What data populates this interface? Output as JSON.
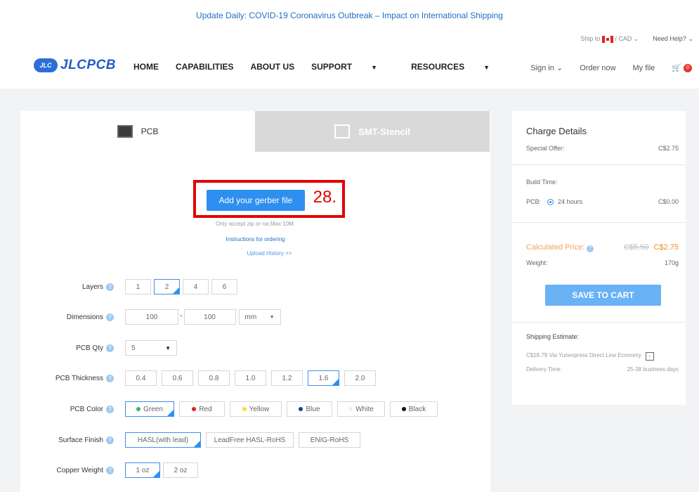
{
  "announcement": "Update Daily: COVID-19 Coronavirus Outbreak – Impact on International Shipping",
  "topbar": {
    "ship_to": "Ship to",
    "currency": "/ CAD",
    "need_help": "Need Help?"
  },
  "brand": {
    "mark": "JLC",
    "name": "JLCPCB"
  },
  "nav": {
    "home": "HOME",
    "capabilities": "CAPABILITIES",
    "about": "ABOUT US",
    "support": "SUPPORT",
    "resources": "RESOURCES"
  },
  "account": {
    "sign_in": "Sign in",
    "order_now": "Order now",
    "my_file": "My file",
    "cart_count": "0"
  },
  "tabs": {
    "pcb": "PCB",
    "stencil": "SMT-Stencil"
  },
  "upload": {
    "button": "Add your gerber file",
    "step_number": "28.",
    "accept_note": "Only accept zip or rar,Max 10M.",
    "instructions": "Instructions for ordering",
    "history": "Upload History >>"
  },
  "form": {
    "layers": {
      "label": "Layers",
      "options": [
        "1",
        "2",
        "4",
        "6"
      ],
      "selected": "2"
    },
    "dimensions": {
      "label": "Dimensions",
      "width": "100",
      "sep": "*",
      "height": "100",
      "unit": "mm"
    },
    "qty": {
      "label": "PCB Qty",
      "value": "5"
    },
    "thickness": {
      "label": "PCB Thickness",
      "options": [
        "0.4",
        "0.6",
        "0.8",
        "1.0",
        "1.2",
        "1.6",
        "2.0"
      ],
      "selected": "1.6"
    },
    "color": {
      "label": "PCB Color",
      "options": [
        "Green",
        "Red",
        "Yellow",
        "Blue",
        "White",
        "Black"
      ],
      "selected": "Green"
    },
    "finish": {
      "label": "Surface Finish",
      "options": [
        "HASL(with lead)",
        "LeadFree HASL-RoHS",
        "ENIG-RoHS"
      ],
      "selected": "HASL(with lead)"
    },
    "copper": {
      "label": "Copper Weight",
      "options": [
        "1 oz",
        "2 oz"
      ],
      "selected": "1 oz"
    }
  },
  "colors": {
    "green": "#2eb872",
    "red": "#e02020",
    "yellow": "#f2e32c",
    "blue": "#1c3f94",
    "white": "#eeeeee",
    "black": "#111111",
    "accent": "#2e8ff0"
  },
  "charges": {
    "title": "Charge Details",
    "special_offer_label": "Special Offer:",
    "special_offer_value": "C$2.75",
    "build_time_label": "Build Time:",
    "pcb_label": "PCB:",
    "build_option": "24 hours",
    "build_price": "C$0.00",
    "calc_label": "Calculated Price:",
    "calc_old": "C$5.50",
    "calc_new": "C$2.75",
    "weight_label": "Weight:",
    "weight_value": "170g",
    "save_button": "SAVE TO CART",
    "shipping_label": "Shipping Estimate:",
    "shipping_value": "C$16.79 Via Yunexpress Direct Line Economy",
    "delivery_label": "Delivery Time:",
    "delivery_value": "25-38 business days"
  }
}
